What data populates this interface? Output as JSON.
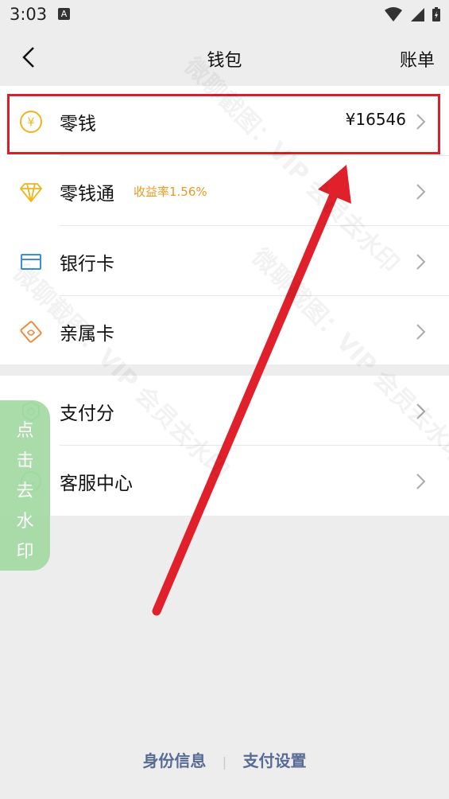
{
  "status": {
    "time": "3:03",
    "a_icon": "A"
  },
  "header": {
    "title": "钱包",
    "right_action": "账单"
  },
  "section1": [
    {
      "label": "零钱",
      "value": "¥16546",
      "icon": "yen-coin-icon"
    },
    {
      "label": "零钱通",
      "badge": "收益率1.56%",
      "icon": "diamond-icon"
    },
    {
      "label": "银行卡",
      "icon": "bank-card-icon"
    },
    {
      "label": "亲属卡",
      "icon": "family-card-icon"
    }
  ],
  "section2": [
    {
      "label": "支付分",
      "icon": "pay-score-icon"
    },
    {
      "label": "客服中心",
      "icon": "customer-service-icon"
    }
  ],
  "floating": {
    "text": "点击去水印"
  },
  "footer": {
    "left": "身份信息",
    "right": "支付设置",
    "separator": "|"
  },
  "watermark": {
    "text": "微聊截图：VIP 会员去水印"
  },
  "colors": {
    "accent_red": "#d9202a",
    "coin_yellow": "#f0b51b",
    "rate_orange": "#e89a1f",
    "link_blue": "#576b95",
    "float_green": "#a6dba6"
  }
}
